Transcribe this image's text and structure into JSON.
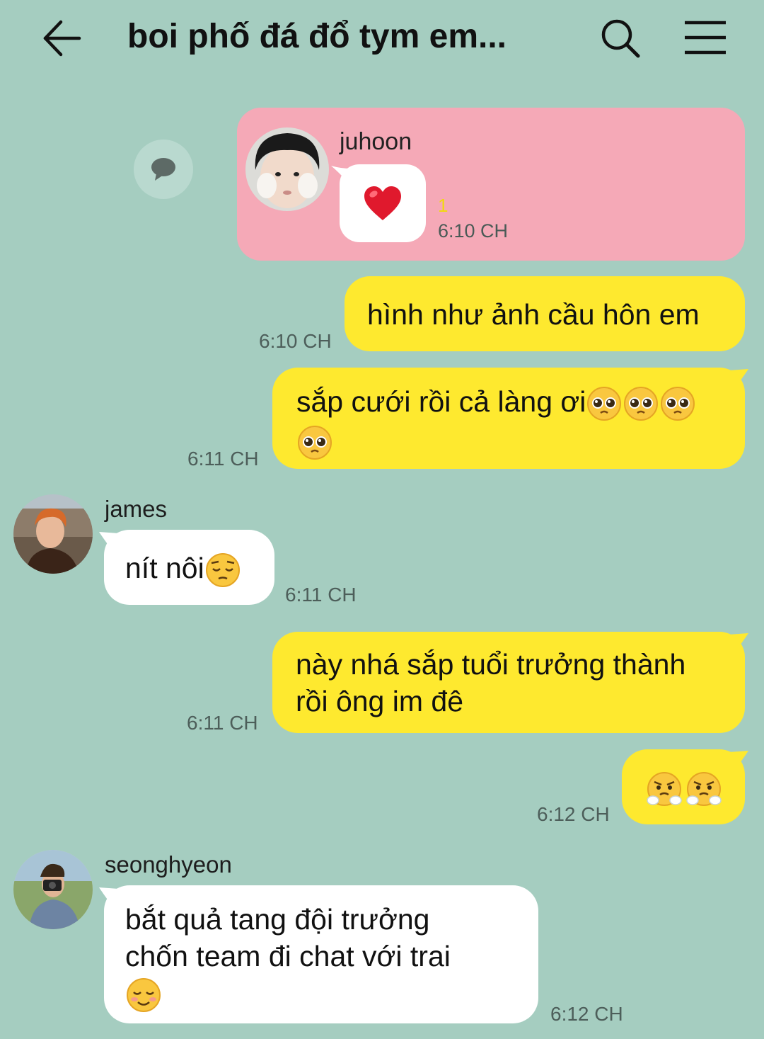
{
  "header": {
    "title": "boi phố đá đổ tym em...",
    "back_icon": "arrow-left-icon",
    "search_icon": "search-icon",
    "menu_icon": "hamburger-menu-icon"
  },
  "colors": {
    "background": "#a5cdc0",
    "my_bubble": "#fee92f",
    "their_bubble": "#ffffff",
    "reply_card": "#f5a9b7",
    "unread": "#f1d90f"
  },
  "reply_card": {
    "sender": "juhoon",
    "message_emoji": "heart-emoji",
    "unread_count": "1",
    "time": "6:10 CH"
  },
  "messages": [
    {
      "from": "me",
      "text": "hình như ảnh cầu hôn em",
      "time": "6:10 CH"
    },
    {
      "from": "me",
      "text": "sắp cưới rồi cả làng ơi",
      "emojis": [
        "pleading-face",
        "pleading-face",
        "pleading-face",
        "pleading-face"
      ],
      "time": "6:11 CH"
    },
    {
      "from": "james",
      "sender": "james",
      "text": "nít nôi",
      "emojis": [
        "pensive-face"
      ],
      "time": "6:11 CH"
    },
    {
      "from": "me",
      "line1": "này nhá sắp tuổi trưởng thành",
      "line2": "rồi ông im đê",
      "time": "6:11 CH"
    },
    {
      "from": "me",
      "emojis": [
        "steam-from-nose-face",
        "steam-from-nose-face"
      ],
      "time": "6:12 CH"
    },
    {
      "from": "seonghyeon",
      "sender": "seonghyeon",
      "line1": "bắt quả tang đội trưởng",
      "line2": "chốn team đi chat với trai",
      "emojis": [
        "smiling-face"
      ],
      "time": "6:12 CH"
    }
  ]
}
